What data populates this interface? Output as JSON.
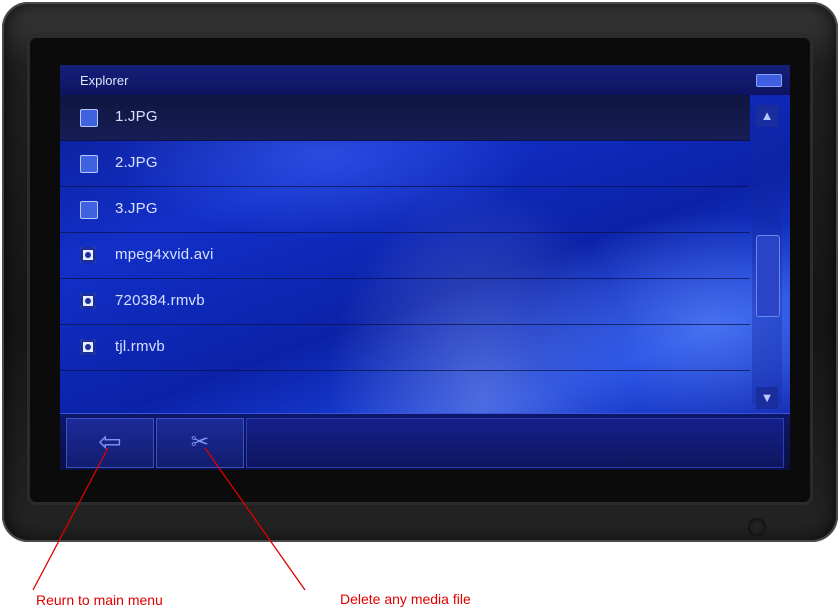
{
  "window": {
    "title": "Explorer"
  },
  "files": [
    {
      "name": "1.JPG",
      "icon": "image-file-icon",
      "selected": true
    },
    {
      "name": "2.JPG",
      "icon": "image-file-icon",
      "selected": false
    },
    {
      "name": "3.JPG",
      "icon": "image-file-icon",
      "selected": false
    },
    {
      "name": "mpeg4xvid.avi",
      "icon": "video-file-icon",
      "selected": false
    },
    {
      "name": "720384.rmvb",
      "icon": "video-file-icon",
      "selected": false
    },
    {
      "name": "tjl.rmvb",
      "icon": "video-file-icon",
      "selected": false
    }
  ],
  "scrollbar": {
    "up_icon": "▲",
    "down_icon": "▼"
  },
  "toolbar": {
    "back_icon": "⇦",
    "delete_icon": "✂"
  },
  "annotations": {
    "back_caption": "Reurn to main menu",
    "delete_caption": "Delete any media file",
    "color": "#e00000"
  }
}
